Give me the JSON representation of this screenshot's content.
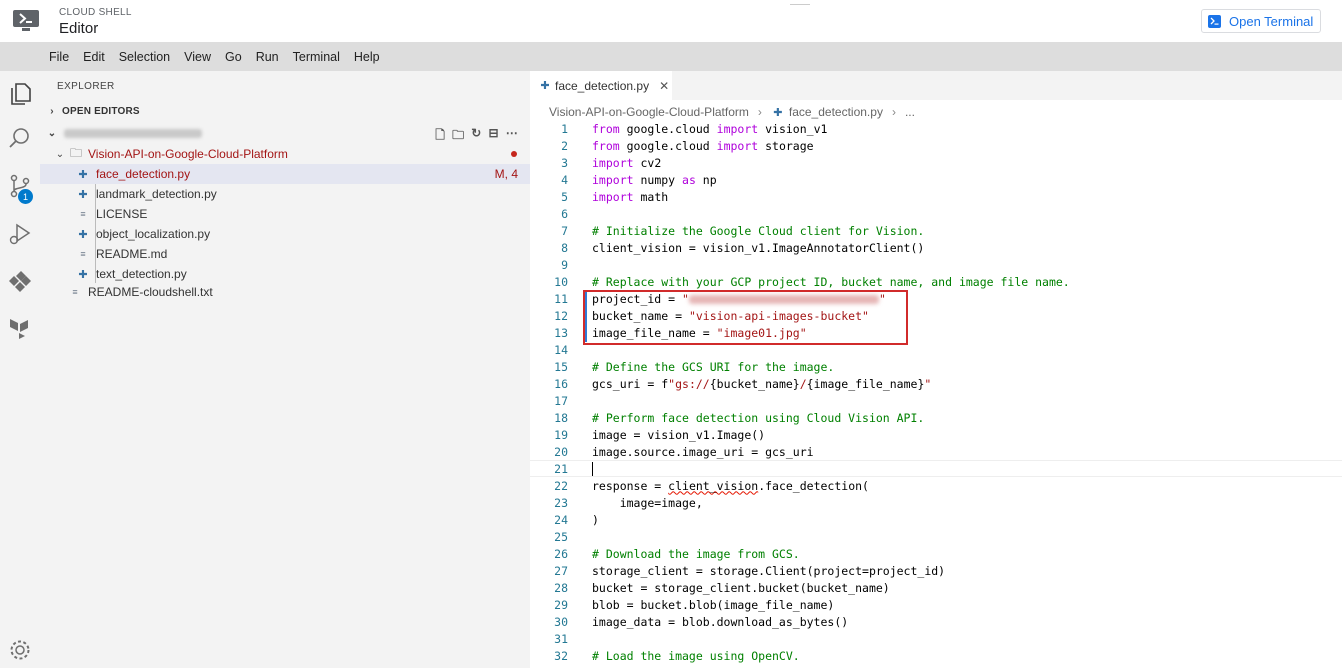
{
  "header": {
    "brand_small": "CLOUD SHELL",
    "brand_big": "Editor",
    "open_terminal_label": "Open Terminal"
  },
  "menu": [
    "File",
    "Edit",
    "Selection",
    "View",
    "Go",
    "Run",
    "Terminal",
    "Help"
  ],
  "activity": {
    "scm_badge": "1",
    "icons": [
      "files-icon",
      "search-icon",
      "source-control-icon",
      "run-debug-icon",
      "extensions-icon",
      "terraform-icon",
      "settings-icon"
    ]
  },
  "explorer": {
    "title": "EXPLORER",
    "open_editors_label": "OPEN EDITORS",
    "workspace_actions": [
      "new-file-icon",
      "new-folder-icon",
      "refresh-icon",
      "collapse-icon",
      "more-icon"
    ],
    "folder": {
      "name": "Vision-API-on-Google-Cloud-Platform",
      "files": [
        {
          "name": "face_detection.py",
          "type": "py",
          "status": "M, 4",
          "selected": true
        },
        {
          "name": "landmark_detection.py",
          "type": "py"
        },
        {
          "name": "LICENSE",
          "type": "txt"
        },
        {
          "name": "object_localization.py",
          "type": "py"
        },
        {
          "name": "README.md",
          "type": "txt"
        },
        {
          "name": "text_detection.py",
          "type": "py"
        }
      ]
    },
    "root_file": "README-cloudshell.txt"
  },
  "editor": {
    "tab_label": "face_detection.py",
    "breadcrumb": [
      "Vision-API-on-Google-Cloud-Platform",
      "face_detection.py",
      "..."
    ],
    "lines": [
      {
        "n": "1",
        "html": "<span class='kw'>from</span> google.cloud <span class='kw'>import</span> vision_v1"
      },
      {
        "n": "2",
        "html": "<span class='kw'>from</span> google.cloud <span class='kw'>import</span> storage"
      },
      {
        "n": "3",
        "html": "<span class='kw'>import</span> cv2"
      },
      {
        "n": "4",
        "html": "<span class='kw'>import</span> numpy <span class='kw'>as</span> np"
      },
      {
        "n": "5",
        "html": "<span class='kw'>import</span> math"
      },
      {
        "n": "6",
        "html": ""
      },
      {
        "n": "7",
        "html": "<span class='cm'># Initialize the Google Cloud client for Vision.</span>"
      },
      {
        "n": "8",
        "html": "client_vision = vision_v1.ImageAnnotatorClient()"
      },
      {
        "n": "9",
        "html": ""
      },
      {
        "n": "10",
        "html": "<span class='cm'># Replace with your GCP project ID, bucket name, and image file name.</span>"
      },
      {
        "n": "11",
        "html": "project_id = <span class='str'>\"<span class='blur-id'></span>\"</span>"
      },
      {
        "n": "12",
        "html": "bucket_name = <span class='str'>\"vision-api-images-bucket\"</span>"
      },
      {
        "n": "13",
        "html": "image_file_name = <span class='str'>\"image01.jpg\"</span>"
      },
      {
        "n": "14",
        "html": ""
      },
      {
        "n": "15",
        "html": "<span class='cm'># Define the GCS URI for the image.</span>"
      },
      {
        "n": "16",
        "html": "gcs_uri = f<span class='str'>\"gs://</span>{bucket_name}<span class='str'>/</span>{image_file_name}<span class='str'>\"</span>"
      },
      {
        "n": "17",
        "html": ""
      },
      {
        "n": "18",
        "html": "<span class='cm'># Perform face detection using Cloud Vision API.</span>"
      },
      {
        "n": "19",
        "html": "image = vision_v1.Image()"
      },
      {
        "n": "20",
        "html": "image.source.image_uri = gcs_uri"
      },
      {
        "n": "21",
        "html": "<span class='caret'></span>"
      },
      {
        "n": "22",
        "html": "response = <span class='squiggle'>client_vision</span>.face_detection("
      },
      {
        "n": "23",
        "html": "    image=image,"
      },
      {
        "n": "24",
        "html": ")"
      },
      {
        "n": "25",
        "html": ""
      },
      {
        "n": "26",
        "html": "<span class='cm'># Download the image from GCS.</span>"
      },
      {
        "n": "27",
        "html": "storage_client = storage.Client(project=project_id)"
      },
      {
        "n": "28",
        "html": "bucket = storage_client.bucket(bucket_name)"
      },
      {
        "n": "29",
        "html": "blob = bucket.blob(image_file_name)"
      },
      {
        "n": "30",
        "html": "image_data = blob.download_as_bytes()"
      },
      {
        "n": "31",
        "html": ""
      },
      {
        "n": "32",
        "html": "<span class='cm'># Load the image using OpenCV.</span>"
      }
    ]
  }
}
